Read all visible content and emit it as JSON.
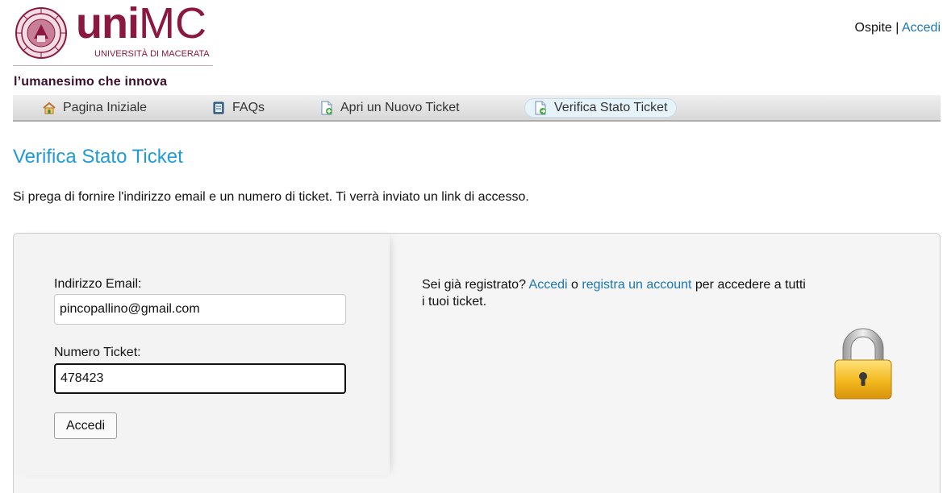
{
  "branding": {
    "logo_word_bold": "uni",
    "logo_word_light": "MC",
    "logo_subtitle": "UNIVERSITÀ DI MACERATA",
    "tagline": "l’umanesimo che innova",
    "brand_color": "#8a1840"
  },
  "user_nav": {
    "guest_label": "Ospite",
    "separator": "|",
    "login_link": "Accedi"
  },
  "nav": {
    "items": [
      {
        "label": "Pagina Iniziale",
        "icon": "home-icon",
        "active": false
      },
      {
        "label": "FAQs",
        "icon": "book-icon",
        "active": false
      },
      {
        "label": "Apri un Nuovo Ticket",
        "icon": "new-ticket-icon",
        "active": false
      },
      {
        "label": "Verifica Stato Ticket",
        "icon": "ticket-status-icon",
        "active": true
      }
    ]
  },
  "page": {
    "title": "Verifica Stato Ticket",
    "intro": "Si prega di fornire l'indirizzo email e un numero di ticket. Ti verrà inviato un link di accesso.",
    "accent_color": "#1f9bd7",
    "link_color": "#1a76b7"
  },
  "form": {
    "email_label": "Indirizzo Email:",
    "email_value": "pincopallino@gmail.com",
    "ticket_label": "Numero Ticket:",
    "ticket_value": "478423",
    "submit_label": "Accedi"
  },
  "side": {
    "text_before": "Sei già registrato? ",
    "login_link": "Accedi",
    "text_middle": " o ",
    "register_link": "registra un account",
    "text_after": " per accedere a tutti i tuoi ticket.",
    "icon": "padlock-icon"
  }
}
